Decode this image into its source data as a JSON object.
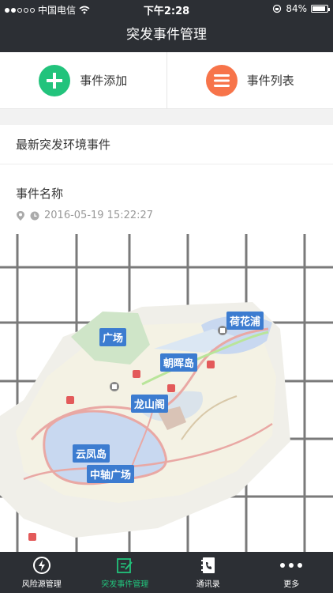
{
  "status": {
    "carrier": "中国电信",
    "time": "下午2:28",
    "battery": "84%"
  },
  "nav": {
    "title": "突发事件管理"
  },
  "actions": {
    "add_label": "事件添加",
    "list_label": "事件列表"
  },
  "section": {
    "title": "最新突发环境事件"
  },
  "event": {
    "name": "事件名称",
    "datetime": "2016-05-19 15:22:27"
  },
  "map": {
    "labels": [
      "荷花浦",
      "广场",
      "朝晖岛",
      "龙山阁",
      "云凤岛",
      "中轴广场"
    ]
  },
  "tabs": [
    {
      "label": "风险源管理",
      "icon": "lightning-icon"
    },
    {
      "label": "突发事件管理",
      "icon": "edit-icon"
    },
    {
      "label": "通讯录",
      "icon": "contacts-icon"
    },
    {
      "label": "更多",
      "icon": "more-icon"
    }
  ],
  "colors": {
    "accent": "#22c37c",
    "orange": "#f7744a",
    "dark": "#2c2f34"
  }
}
